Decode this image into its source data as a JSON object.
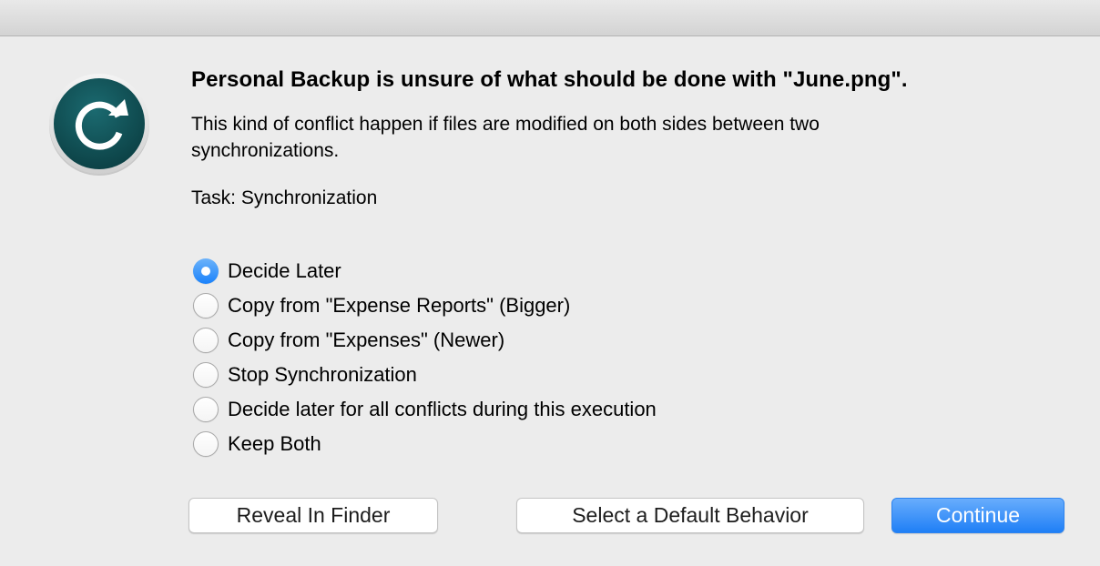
{
  "dialog": {
    "title": "Personal Backup is unsure of what should be done with \"June.png\".",
    "message": "This kind of conflict happen if files are modified on both sides between two synchronizations.",
    "task": "Task: Synchronization",
    "icon": "sync-icon",
    "accent_color": "#1a82fb",
    "icon_color": "#0f4c51"
  },
  "options": [
    {
      "label": "Decide Later",
      "selected": true
    },
    {
      "label": "Copy from \"Expense Reports\" (Bigger)",
      "selected": false
    },
    {
      "label": "Copy from \"Expenses\" (Newer)",
      "selected": false
    },
    {
      "label": "Stop Synchronization",
      "selected": false
    },
    {
      "label": "Decide later for all conflicts during this execution",
      "selected": false
    },
    {
      "label": "Keep Both",
      "selected": false
    }
  ],
  "buttons": {
    "reveal": "Reveal In Finder",
    "default_behavior": "Select a Default Behavior",
    "continue": "Continue"
  }
}
